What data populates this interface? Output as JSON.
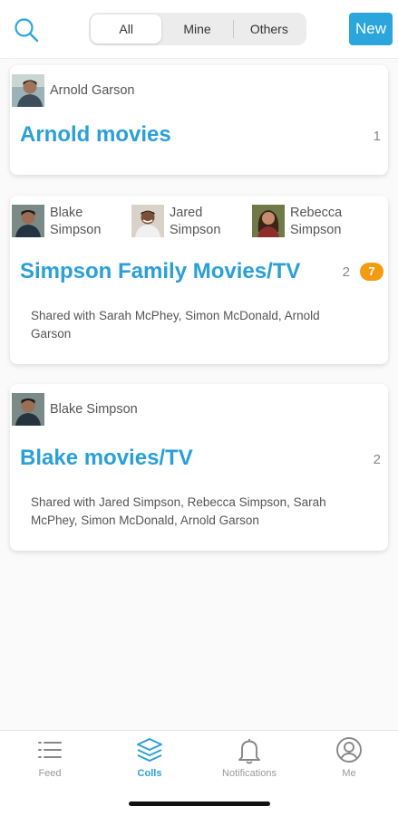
{
  "header": {
    "search_icon": "search-icon",
    "tabs": [
      "All",
      "Mine",
      "Others"
    ],
    "active_tab": "All",
    "new_label": "New",
    "accent": "#2aa6dd"
  },
  "colls": [
    {
      "members": [
        "Arnold Garson"
      ],
      "title": "Arnold movies",
      "count": "1"
    },
    {
      "members": [
        {
          "first": "Blake",
          "last": "Simpson"
        },
        {
          "first": "Jared",
          "last": "Simpson"
        },
        {
          "first": "Rebecca",
          "last": "Simpson"
        }
      ],
      "title": "Simpson Family Movies/TV",
      "count": "2",
      "badge": "7",
      "shared": "Shared with Sarah McPhey, Simon McDonald, Arnold Garson"
    },
    {
      "members": [
        "Blake Simpson"
      ],
      "title": "Blake movies/TV",
      "count": "2",
      "shared": "Shared with Jared Simpson, Rebecca Simpson, Sarah McPhey, Simon McDonald, Arnold Garson"
    }
  ],
  "tabbar": {
    "items": [
      {
        "label": "Feed",
        "icon": "list-icon"
      },
      {
        "label": "Colls",
        "icon": "layers-icon"
      },
      {
        "label": "Notifications",
        "icon": "bell-icon"
      },
      {
        "label": "Me",
        "icon": "user-icon"
      }
    ],
    "active": "Colls"
  },
  "colors": {
    "title": "#2a9fd8",
    "badge": "#f39c12",
    "inactive_tab": "#999999"
  }
}
